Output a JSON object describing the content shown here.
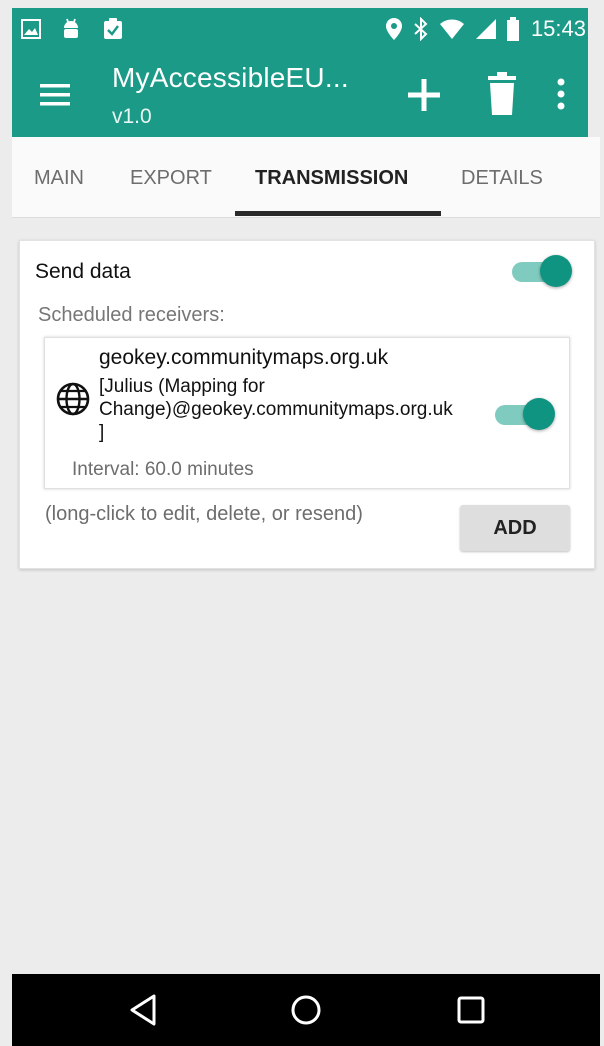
{
  "status_bar": {
    "time": "15:43",
    "left_icons": [
      "image-icon",
      "android-icon",
      "clipboard-check-icon"
    ],
    "right_icons": [
      "location-icon",
      "bluetooth-icon",
      "wifi-icon",
      "signal-icon",
      "battery-icon"
    ]
  },
  "app_bar": {
    "title": "MyAccessibleEU...",
    "subtitle": "v1.0",
    "background_color": "#1a9a87",
    "actions": [
      "menu-icon",
      "plus-icon",
      "trash-icon",
      "more-vert-icon"
    ]
  },
  "tabs": [
    {
      "label": "MAIN",
      "active": false
    },
    {
      "label": "EXPORT",
      "active": false
    },
    {
      "label": "TRANSMISSION",
      "active": true
    },
    {
      "label": "DETAILS",
      "active": false
    }
  ],
  "transmission": {
    "send_data_label": "Send data",
    "send_data_enabled": true,
    "scheduled_receivers_label": "Scheduled receivers:",
    "receivers": [
      {
        "name": "geokey.communitymaps.org.uk",
        "detail_lines": [
          "[Julius (Mapping for",
          "Change)@geokey.communitymaps.org.uk",
          "]"
        ],
        "interval": "Interval: 60.0 minutes",
        "enabled": true
      }
    ],
    "hint": "(long-click to edit, delete, or resend)",
    "add_button_label": "ADD"
  },
  "nav_bar": {
    "buttons": [
      "back-icon",
      "home-icon",
      "recents-icon"
    ]
  },
  "colors": {
    "accent": "#109482",
    "accent_track": "#80cbbf"
  }
}
